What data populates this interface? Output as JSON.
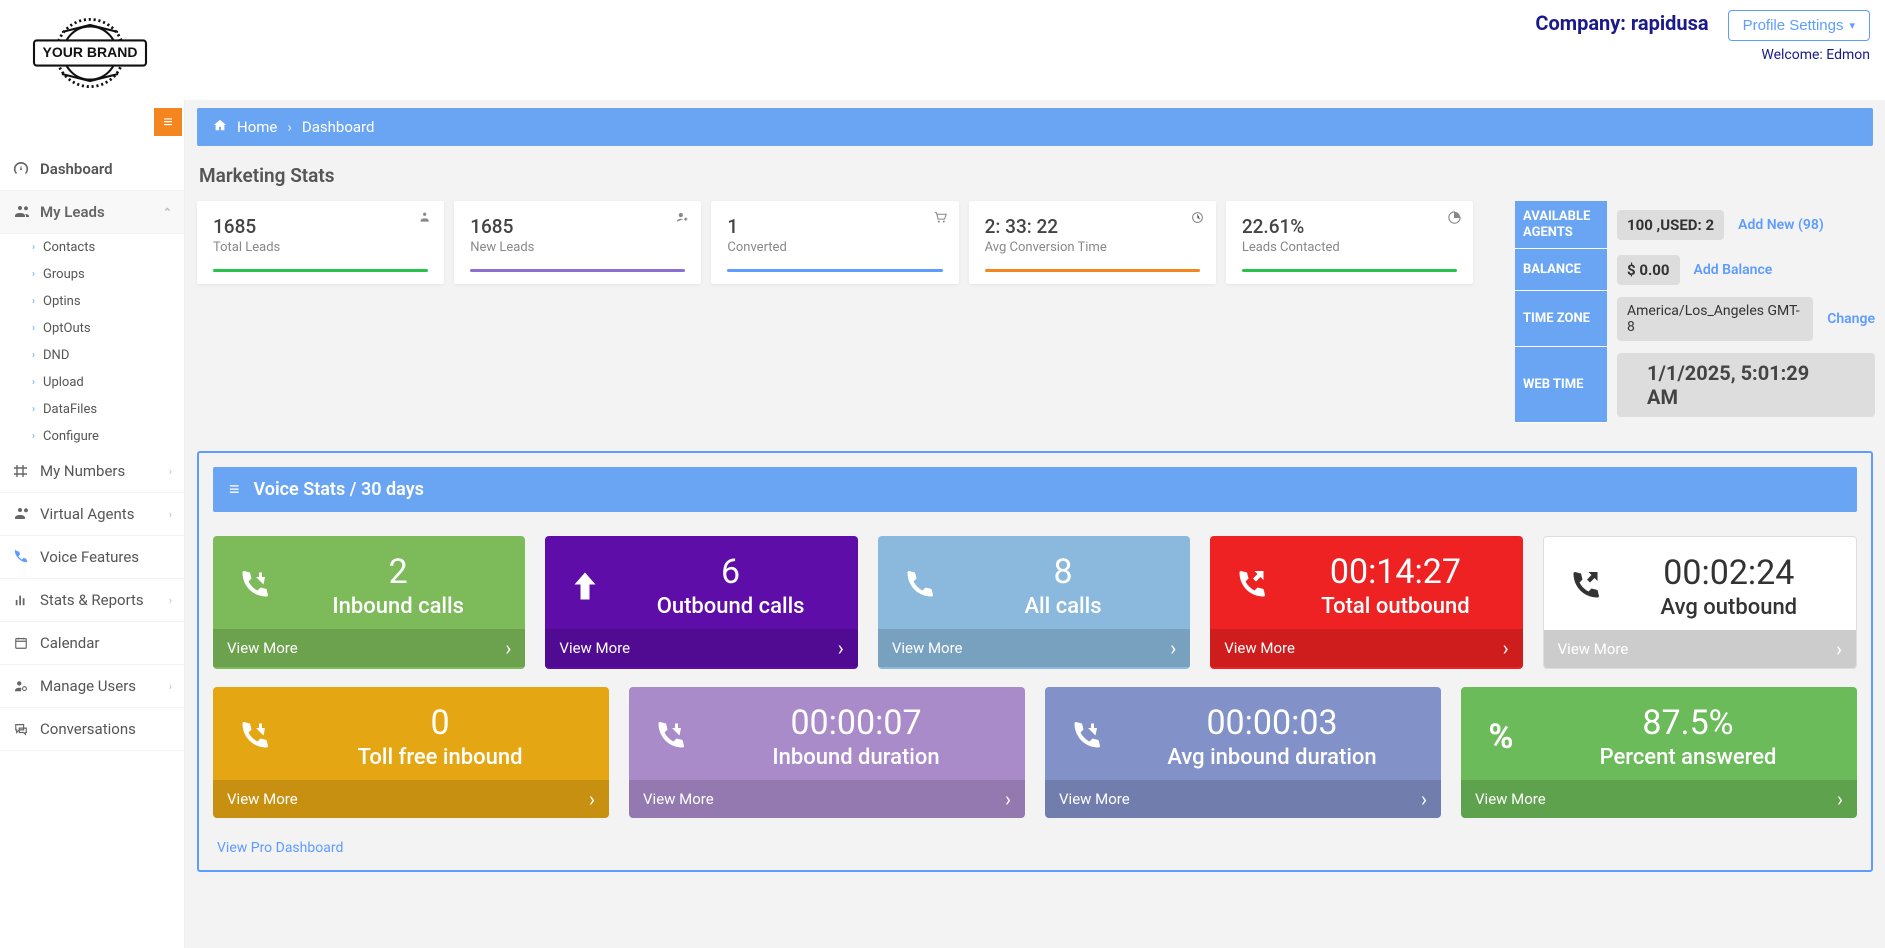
{
  "header": {
    "company_label": "Company: rapidusa",
    "profile_btn": "Profile Settings",
    "welcome": "Welcome: Edmon"
  },
  "breadcrumb": {
    "home": "Home",
    "current": "Dashboard"
  },
  "page_title": "Marketing Stats",
  "sidebar": {
    "items": [
      {
        "label": "Dashboard"
      },
      {
        "label": "My Leads"
      },
      {
        "label": "My Numbers"
      },
      {
        "label": "Virtual Agents"
      },
      {
        "label": "Voice Features"
      },
      {
        "label": "Stats & Reports"
      },
      {
        "label": "Calendar"
      },
      {
        "label": "Manage Users"
      },
      {
        "label": "Conversations"
      }
    ],
    "leads_sub": [
      "Contacts",
      "Groups",
      "Optins",
      "OptOuts",
      "DND",
      "Upload",
      "DataFiles",
      "Configure"
    ]
  },
  "stats": [
    {
      "value": "1685",
      "label": "Total Leads",
      "bar": "#27c24c"
    },
    {
      "value": "1685",
      "label": "New Leads",
      "bar": "#8c6fd1"
    },
    {
      "value": "1",
      "label": "Converted",
      "bar": "#5e9cff"
    },
    {
      "value": "2: 33: 22",
      "label": "Avg Conversion Time",
      "bar": "#f5851f"
    },
    {
      "value": "22.61%",
      "label": "Leads Contacted",
      "bar": "#27c24c"
    }
  ],
  "info": {
    "agents_label": "AVAILABLE AGENTS",
    "agents_value": "100 ,USED: 2",
    "agents_link": "Add New (98)",
    "balance_label": "BALANCE",
    "balance_value": "$ 0.00",
    "balance_link": "Add Balance",
    "tz_label": "TIME ZONE",
    "tz_value": "America/Los_Angeles GMT-8",
    "tz_link": "Change",
    "webtime_label": "WEB TIME",
    "webtime_value": "1/1/2025, 5:01:29 AM"
  },
  "voice": {
    "header": "Voice Stats / 30 days",
    "view_more": "View More",
    "pro_link": "View Pro Dashboard",
    "row1": [
      {
        "value": "2",
        "label": "Inbound calls",
        "icon": "phone-in",
        "color": "c-green"
      },
      {
        "value": "6",
        "label": "Outbound calls",
        "icon": "arrow-up",
        "color": "c-purple"
      },
      {
        "value": "8",
        "label": "All calls",
        "icon": "phone",
        "color": "c-lightblue"
      },
      {
        "value": "00:14:27",
        "label": "Total outbound",
        "icon": "phone-out",
        "color": "c-red"
      },
      {
        "value": "00:02:24",
        "label": "Avg outbound",
        "icon": "phone-out",
        "color": "white"
      }
    ],
    "row2": [
      {
        "value": "0",
        "label": "Toll free inbound",
        "icon": "phone-in",
        "color": "c-orange"
      },
      {
        "value": "00:00:07",
        "label": "Inbound duration",
        "icon": "phone-in",
        "color": "c-lav"
      },
      {
        "value": "00:00:03",
        "label": "Avg inbound duration",
        "icon": "phone-in",
        "color": "c-slate"
      },
      {
        "value": "87.5%",
        "label": "Percent answered",
        "icon": "percent",
        "color": "c-green2"
      }
    ]
  }
}
